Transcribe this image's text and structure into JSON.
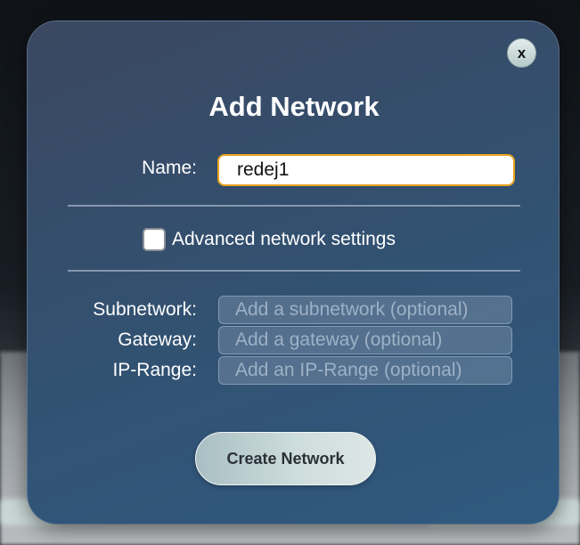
{
  "dialog": {
    "title": "Add Network",
    "close_label": "x",
    "name_label": "Name:",
    "name_value": "redej1",
    "advanced_label": "Advanced network settings",
    "advanced_checked": false,
    "subnetwork_label": "Subnetwork:",
    "subnetwork_placeholder": "Add a subnetwork (optional)",
    "gateway_label": "Gateway:",
    "gateway_placeholder": "Add a gateway (optional)",
    "iprange_label": "IP-Range:",
    "iprange_placeholder": "Add an IP-Range (optional)",
    "create_label": "Create Network"
  },
  "colors": {
    "accent_focus": "#e8a21f",
    "modal_bg": "#33506f",
    "button_bg": "#cddcdc"
  },
  "icons": {
    "close": "close-icon"
  }
}
